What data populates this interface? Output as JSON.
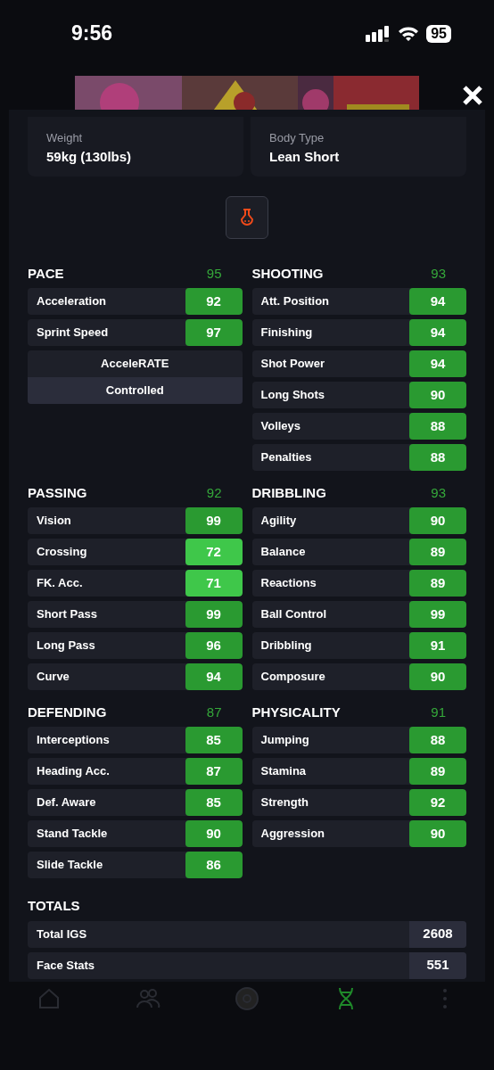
{
  "status_bar": {
    "time": "9:56",
    "battery": "95"
  },
  "info": [
    {
      "label": "Weight",
      "value": "59kg (130lbs)"
    },
    {
      "label": "Body Type",
      "value": "Lean Short"
    }
  ],
  "sections": [
    {
      "title": "PACE",
      "score": "95",
      "stats": [
        {
          "name": "Acceleration",
          "value": "92",
          "color": "#2a9a31"
        },
        {
          "name": "Sprint Speed",
          "value": "97",
          "color": "#2a9a31"
        }
      ],
      "accelerate": {
        "label": "AcceleRATE",
        "value": "Controlled"
      }
    },
    {
      "title": "SHOOTING",
      "score": "93",
      "stats": [
        {
          "name": "Att. Position",
          "value": "94",
          "color": "#2a9a31"
        },
        {
          "name": "Finishing",
          "value": "94",
          "color": "#2a9a31"
        },
        {
          "name": "Shot Power",
          "value": "94",
          "color": "#2a9a31"
        },
        {
          "name": "Long Shots",
          "value": "90",
          "color": "#2a9a31"
        },
        {
          "name": "Volleys",
          "value": "88",
          "color": "#2a9a31"
        },
        {
          "name": "Penalties",
          "value": "88",
          "color": "#2a9a31"
        }
      ]
    },
    {
      "title": "PASSING",
      "score": "92",
      "stats": [
        {
          "name": "Vision",
          "value": "99",
          "color": "#2a9a31"
        },
        {
          "name": "Crossing",
          "value": "72",
          "color": "#3fc74a"
        },
        {
          "name": "FK. Acc.",
          "value": "71",
          "color": "#3fc74a"
        },
        {
          "name": "Short Pass",
          "value": "99",
          "color": "#2a9a31"
        },
        {
          "name": "Long Pass",
          "value": "96",
          "color": "#2a9a31"
        },
        {
          "name": "Curve",
          "value": "94",
          "color": "#2a9a31"
        }
      ]
    },
    {
      "title": "DRIBBLING",
      "score": "93",
      "stats": [
        {
          "name": "Agility",
          "value": "90",
          "color": "#2a9a31"
        },
        {
          "name": "Balance",
          "value": "89",
          "color": "#2a9a31"
        },
        {
          "name": "Reactions",
          "value": "89",
          "color": "#2a9a31"
        },
        {
          "name": "Ball Control",
          "value": "99",
          "color": "#2a9a31"
        },
        {
          "name": "Dribbling",
          "value": "91",
          "color": "#2a9a31"
        },
        {
          "name": "Composure",
          "value": "90",
          "color": "#2a9a31"
        }
      ]
    },
    {
      "title": "DEFENDING",
      "score": "87",
      "stats": [
        {
          "name": "Interceptions",
          "value": "85",
          "color": "#2a9a31"
        },
        {
          "name": "Heading Acc.",
          "value": "87",
          "color": "#2a9a31"
        },
        {
          "name": "Def. Aware",
          "value": "85",
          "color": "#2a9a31"
        },
        {
          "name": "Stand Tackle",
          "value": "90",
          "color": "#2a9a31"
        },
        {
          "name": "Slide Tackle",
          "value": "86",
          "color": "#2a9a31"
        }
      ]
    },
    {
      "title": "PHYSICALITY",
      "score": "91",
      "stats": [
        {
          "name": "Jumping",
          "value": "88",
          "color": "#2a9a31"
        },
        {
          "name": "Stamina",
          "value": "89",
          "color": "#2a9a31"
        },
        {
          "name": "Strength",
          "value": "92",
          "color": "#2a9a31"
        },
        {
          "name": "Aggression",
          "value": "90",
          "color": "#2a9a31"
        }
      ]
    }
  ],
  "totals": {
    "title": "TOTALS",
    "rows": [
      {
        "label": "Total IGS",
        "value": "2608"
      },
      {
        "label": "Face Stats",
        "value": "551"
      }
    ]
  },
  "bottom_nav": [
    {
      "kind": "home",
      "selected": false
    },
    {
      "kind": "people",
      "selected": false
    },
    {
      "kind": "ball",
      "selected": false
    },
    {
      "kind": "dna",
      "selected": true
    },
    {
      "kind": "more",
      "selected": false
    }
  ]
}
